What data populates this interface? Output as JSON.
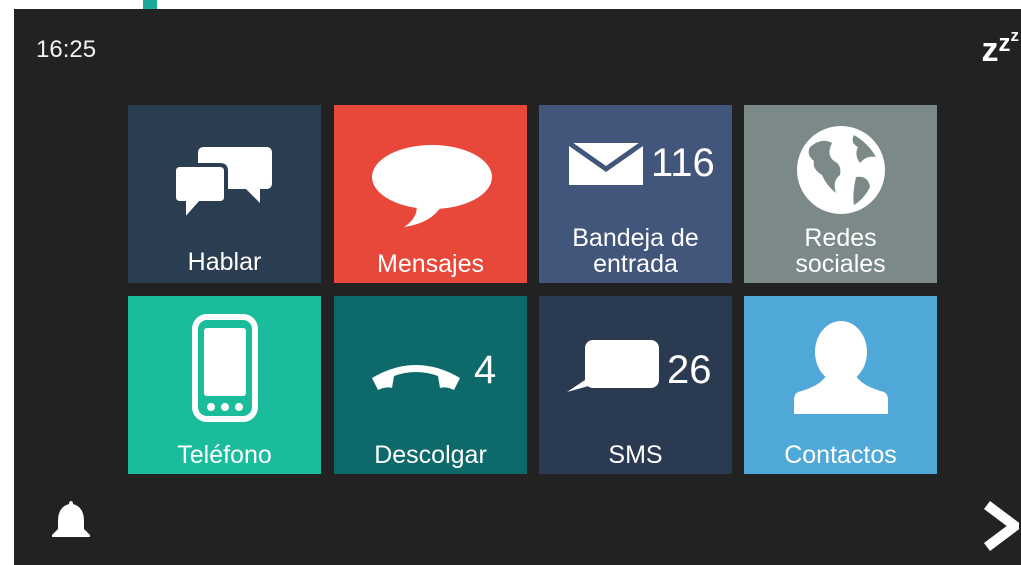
{
  "status": {
    "time": "16:25",
    "sleep_icon": "sleep-zzz-icon"
  },
  "colors": {
    "screen_bg": "#222222",
    "hablar": "#2b3d51",
    "mensajes": "#e8483a",
    "bandeja": "#42557a",
    "redes": "#7b8a88",
    "telefono": "#1bbc9c",
    "descolgar": "#0e6a6a",
    "sms": "#2a3a50",
    "contactos": "#4fa8d8",
    "accent": "#1aa99a"
  },
  "tiles": [
    {
      "id": "hablar",
      "label": "Hablar",
      "icon": "chat-bubbles-icon"
    },
    {
      "id": "mensajes",
      "label": "Mensajes",
      "icon": "speech-bubble-icon"
    },
    {
      "id": "bandeja",
      "label_line1": "Bandeja de",
      "label_line2": "entrada",
      "count": "116",
      "icon": "envelope-icon"
    },
    {
      "id": "redes",
      "label_line1": "Redes",
      "label_line2": "sociales",
      "icon": "globe-icon"
    },
    {
      "id": "telefono",
      "label": "Teléfono",
      "icon": "mobile-phone-icon"
    },
    {
      "id": "descolgar",
      "label": "Descolgar",
      "count": "4",
      "icon": "phone-handset-icon"
    },
    {
      "id": "sms",
      "label": "SMS",
      "count": "26",
      "icon": "sms-bubble-icon"
    },
    {
      "id": "contactos",
      "label": "Contactos",
      "icon": "person-icon"
    }
  ],
  "footer": {
    "bell_icon": "bell-icon",
    "next_icon": "chevron-right-icon"
  }
}
